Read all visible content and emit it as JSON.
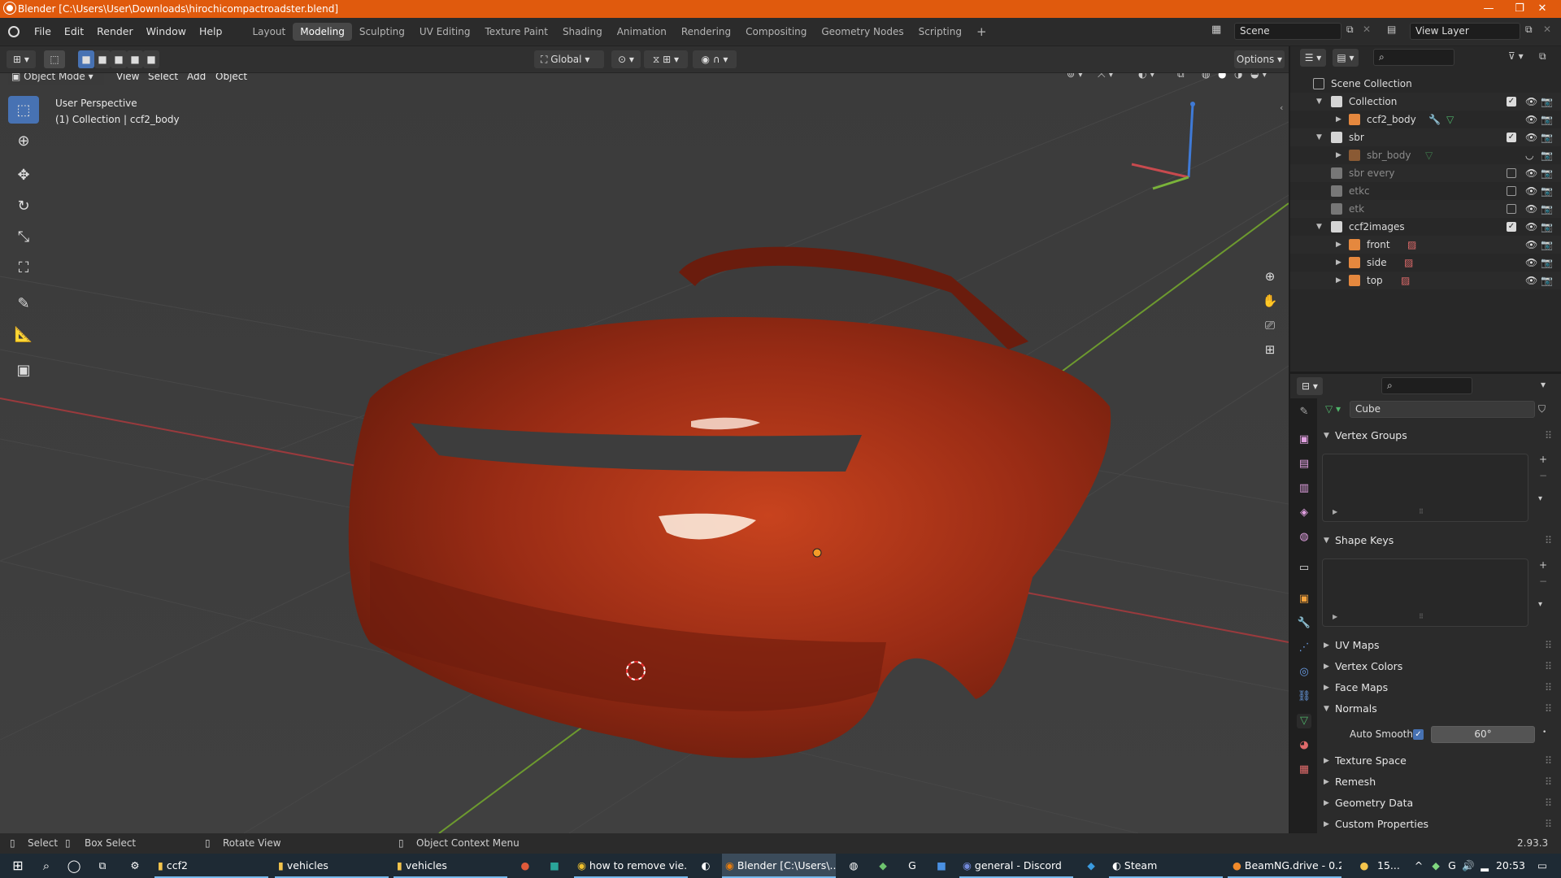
{
  "window": {
    "title": "Blender [C:\\Users\\User\\Downloads\\hirochicompactroadster.blend]",
    "minimize": "—",
    "maximize": "❐",
    "close": "✕"
  },
  "menu": [
    "File",
    "Edit",
    "Render",
    "Window",
    "Help"
  ],
  "workspaces": [
    "Layout",
    "Modeling",
    "Sculpting",
    "UV Editing",
    "Texture Paint",
    "Shading",
    "Animation",
    "Rendering",
    "Compositing",
    "Geometry Nodes",
    "Scripting"
  ],
  "active_workspace": "Modeling",
  "add_workspace": "+",
  "scene": {
    "name": "Scene",
    "view_layer": "View Layer"
  },
  "header": {
    "transform_orientation": "Global",
    "options": "Options"
  },
  "viewport_header": {
    "mode": "Object Mode",
    "menus": [
      "View",
      "Select",
      "Add",
      "Object"
    ]
  },
  "viewport": {
    "view_name": "User Perspective",
    "context": "(1) Collection | ccf2_body"
  },
  "outliner": {
    "root": "Scene Collection",
    "rows": [
      {
        "label": "Collection",
        "type": "collection",
        "enabled": true
      },
      {
        "label": "ccf2_body",
        "type": "mesh",
        "enabled": true
      },
      {
        "label": "sbr",
        "type": "collection",
        "enabled": true
      },
      {
        "label": "sbr_body",
        "type": "mesh",
        "enabled": false
      },
      {
        "label": "sbr every",
        "type": "collection",
        "enabled": false
      },
      {
        "label": "etkc",
        "type": "collection",
        "enabled": false
      },
      {
        "label": "etk",
        "type": "collection",
        "enabled": false
      },
      {
        "label": "ccf2images",
        "type": "collection",
        "enabled": true
      },
      {
        "label": "front",
        "type": "image",
        "enabled": true
      },
      {
        "label": "side",
        "type": "image",
        "enabled": true
      },
      {
        "label": "top",
        "type": "image",
        "enabled": true
      }
    ]
  },
  "properties": {
    "mesh_name": "Cube",
    "panels": [
      {
        "label": "Vertex Groups",
        "open": true
      },
      {
        "label": "Shape Keys",
        "open": true
      },
      {
        "label": "UV Maps",
        "open": false
      },
      {
        "label": "Vertex Colors",
        "open": false
      },
      {
        "label": "Face Maps",
        "open": false
      },
      {
        "label": "Normals",
        "open": true
      },
      {
        "label": "Texture Space",
        "open": false
      },
      {
        "label": "Remesh",
        "open": false
      },
      {
        "label": "Geometry Data",
        "open": false
      },
      {
        "label": "Custom Properties",
        "open": false
      }
    ],
    "auto_smooth_label": "Auto Smooth",
    "auto_smooth_angle": "60°"
  },
  "status": {
    "select": "Select",
    "box_select": "Box Select",
    "rotate_view": "Rotate View",
    "context_menu": "Object Context Menu",
    "version": "2.93.3"
  },
  "taskbar": {
    "items": [
      "ccf2",
      "vehicles",
      "vehicles",
      "how to remove vie...",
      "Blender [C:\\Users\\...",
      "general - Discord",
      "Steam",
      "BeamNG.drive - 0.2..."
    ],
    "weather": "15...",
    "time": "20:53"
  },
  "colors": {
    "accent": "#e05a0d",
    "active_tool": "#4772b3",
    "car_body": "#a3301a",
    "x_axis": "#c84a4e",
    "y_axis": "#7ab33a",
    "z_axis": "#3f7ad6"
  }
}
